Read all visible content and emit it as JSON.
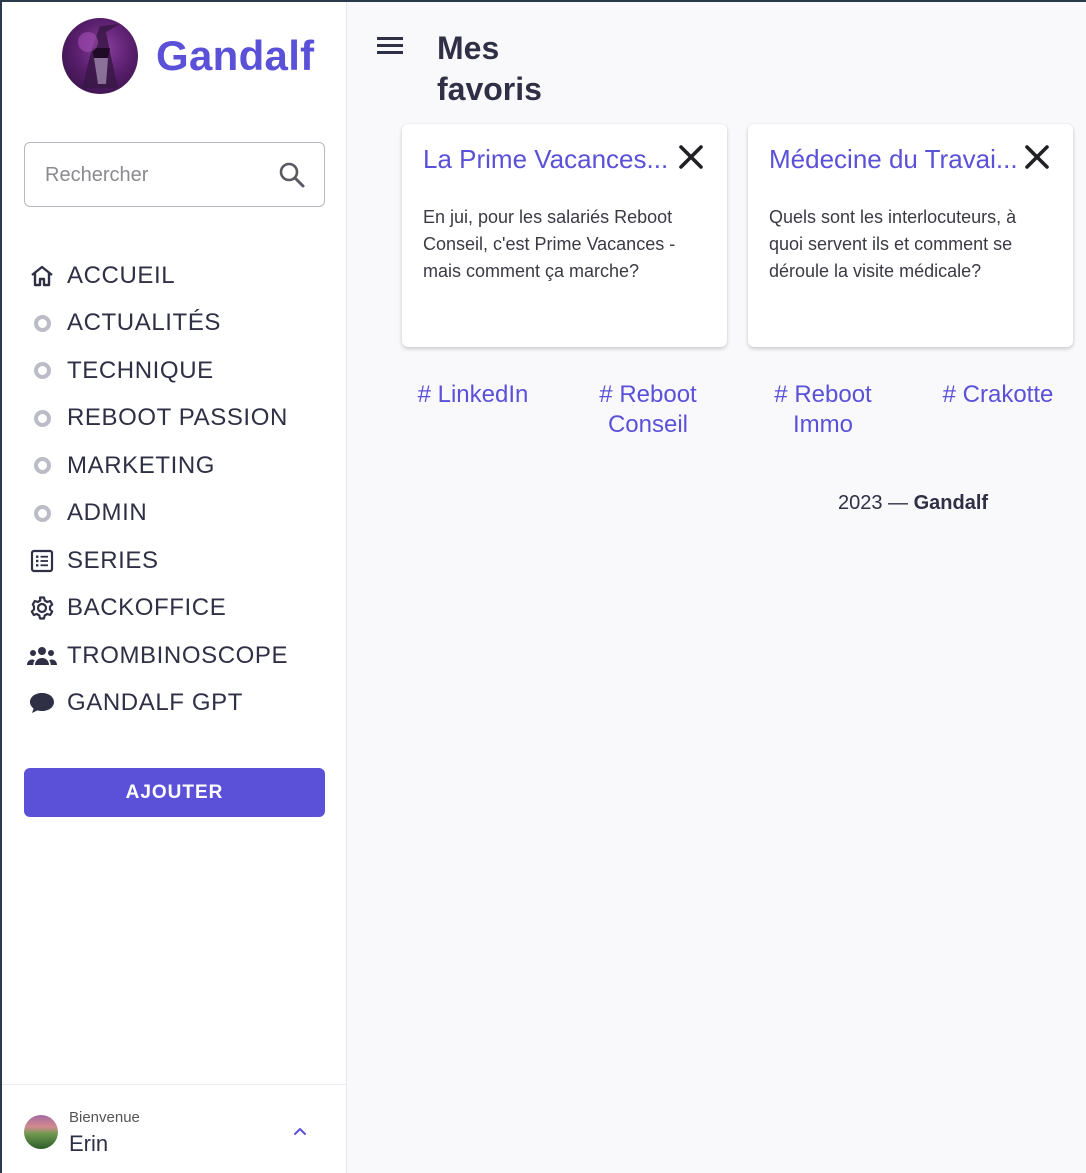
{
  "brand": {
    "name": "Gandalf",
    "accent": "#5b51d8"
  },
  "search": {
    "placeholder": "Rechercher",
    "icon": "search-icon"
  },
  "nav": {
    "items": [
      {
        "label": "ACCUEIL",
        "icon": "home-icon"
      },
      {
        "label": "ACTUALITÉS",
        "icon": "circle-icon"
      },
      {
        "label": "TECHNIQUE",
        "icon": "circle-icon"
      },
      {
        "label": "REBOOT PASSION",
        "icon": "circle-icon"
      },
      {
        "label": "MARKETING",
        "icon": "circle-icon"
      },
      {
        "label": "ADMIN",
        "icon": "circle-icon"
      },
      {
        "label": "SERIES",
        "icon": "list-icon"
      },
      {
        "label": "BACKOFFICE",
        "icon": "gear-icon"
      },
      {
        "label": "TROMBINOSCOPE",
        "icon": "group-icon"
      },
      {
        "label": "GANDALF GPT",
        "icon": "chat-bubble-icon"
      }
    ]
  },
  "actions": {
    "add_label": "AJOUTER"
  },
  "user": {
    "welcome": "Bienvenue",
    "name": "Erin"
  },
  "main": {
    "title": "Mes favoris",
    "cards": [
      {
        "title": "La Prime Vacances - Reboot Conseil",
        "title_display": "La Prime Vacances...",
        "description": "En jui, pour les salariés Reboot Conseil, c'est Prime Vacances - mais comment ça marche?"
      },
      {
        "title": "Médecine du Travail",
        "title_display": "Médecine du Travai...",
        "description": "Quels sont les interlocuteurs, à quoi servent ils et comment se déroule la visite médicale?"
      }
    ],
    "tags": [
      "# LinkedIn",
      "# Reboot Conseil",
      "# Reboot Immo",
      "# Crakotte"
    ]
  },
  "footer": {
    "year": "2023 —",
    "name": "Gandalf"
  }
}
